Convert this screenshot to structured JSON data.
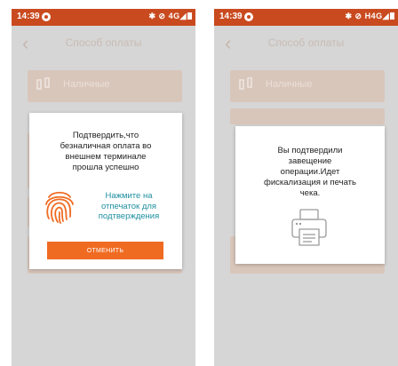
{
  "status_bar": {
    "left": {
      "time": "14:39",
      "icons": "✱ ⊘ 4G◢"
    },
    "right": {
      "time": "14:39",
      "icons": "✱ ⊘ H4G◢"
    }
  },
  "app_bar": {
    "back_icon": "chevron-left-icon",
    "title": "Способ оплаты"
  },
  "payment_methods": {
    "cash_label": "Наличные",
    "cash_icon": "cash-icon"
  },
  "dialog_confirm": {
    "message": "Подтвердить,что\nбезналичная оплата во\nвнешнем терминале\nпрошла успешно",
    "fingerprint_icon": "fingerprint-icon",
    "hint": "Нажмите на\nотпечаток для\nподтверждения",
    "cancel_label": "ОТМЕНИТЬ"
  },
  "dialog_fiscal": {
    "message": "Вы подтвердили\nзавещение\nоперации.Идет\nфискализация и печать\nчека.",
    "printer_icon": "printer-icon"
  },
  "colors": {
    "status_bar": "#c94a1f",
    "accent": "#f06b22",
    "hint_text": "#1f8fa0",
    "overlay_bg": "#d6d6d6",
    "card_bg": "#d9c6bb"
  }
}
